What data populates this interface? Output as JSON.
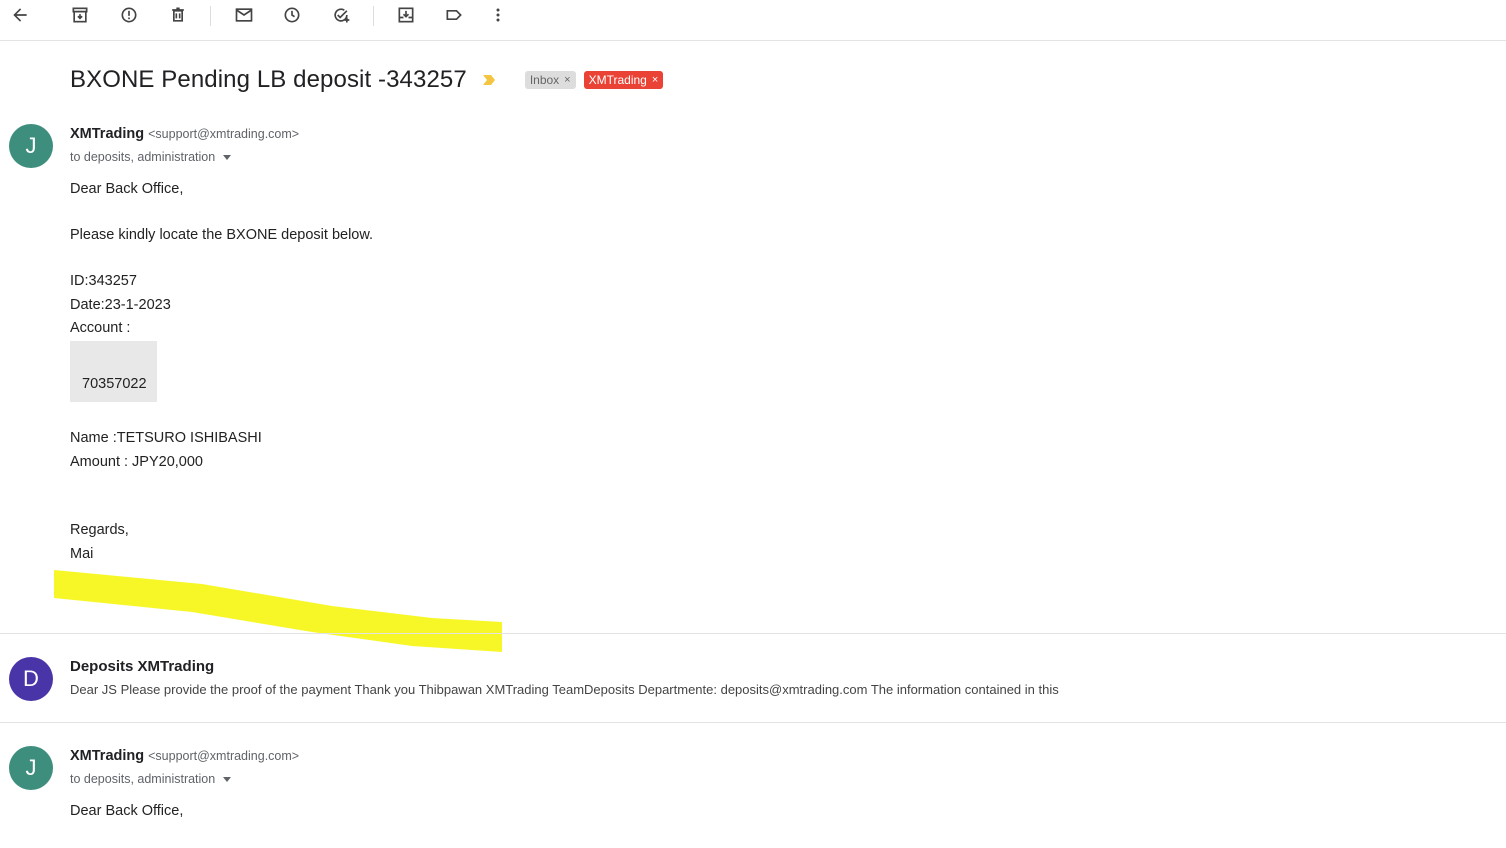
{
  "toolbar": {
    "icons": [
      "back-arrow-icon",
      "archive-icon",
      "report-spam-icon",
      "delete-icon",
      "mark-unread-icon",
      "snooze-icon",
      "add-task-icon",
      "move-to-icon",
      "label-icon",
      "more-vert-icon"
    ]
  },
  "thread": {
    "subject": "BXONE Pending LB deposit -343257",
    "labels": [
      {
        "name": "Inbox",
        "remove": "×"
      },
      {
        "name": "XMTrading",
        "remove": "×",
        "color": "#ea4335"
      }
    ]
  },
  "messages": [
    {
      "avatar_letter": "J",
      "avatar_color": "#3e8e7e",
      "sender_name": "XMTrading",
      "sender_email": "<support@xmtrading.com>",
      "recipients": "to deposits, administration",
      "greeting": "Dear Back Office,",
      "intro": "Please kindly locate the BXONE deposit below.",
      "id_line": "ID:343257",
      "date_line": "Date:23-1-2023",
      "account_label": "Account :",
      "account_number": "70357022",
      "name_line": "Name  :TETSURO ISHIBASHI",
      "amount_line": "Amount  :  JPY20,000",
      "closing": "Regards,",
      "signature": "Mai"
    },
    {
      "avatar_letter": "D",
      "avatar_color": "#4a35a8",
      "sender_name": "Deposits XMTrading",
      "snippet": "Dear JS Please provide the proof of the payment Thank you Thibpawan XMTrading TeamDeposits Departmente: deposits@xmtrading.com The information contained in this"
    },
    {
      "avatar_letter": "J",
      "avatar_color": "#3e8e7e",
      "sender_name": "XMTrading",
      "sender_email": "<support@xmtrading.com>",
      "recipients": "to deposits, administration",
      "greeting": "Dear Back Office,"
    }
  ],
  "colors": {
    "highlight": "#f7f728",
    "importance": "#f4c542"
  }
}
